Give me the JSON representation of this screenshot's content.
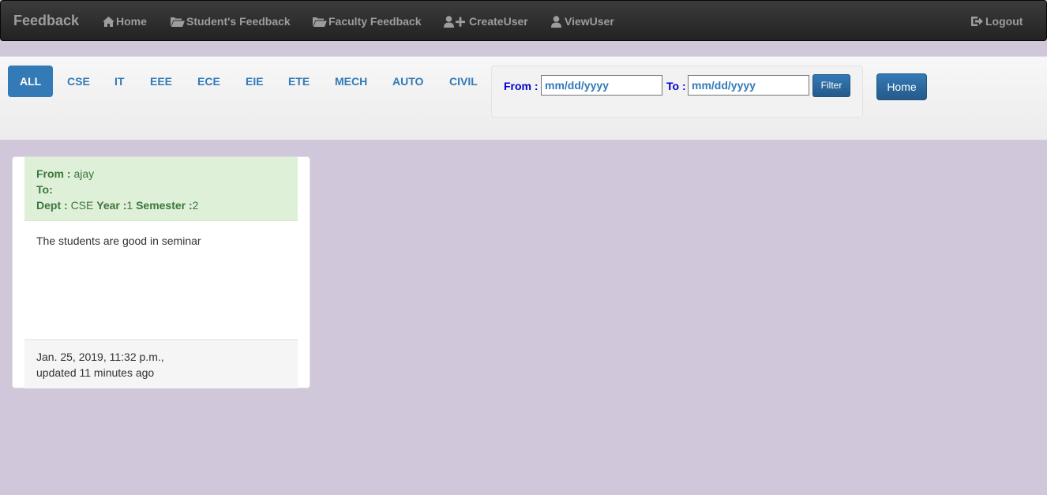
{
  "navbar": {
    "brand": "Feedback",
    "items": [
      {
        "label": "Home",
        "icon": "home-icon"
      },
      {
        "label": "Student's Feedback",
        "icon": "folder-open-icon"
      },
      {
        "label": "Faculty Feedback",
        "icon": "folder-open-icon"
      },
      {
        "label": "CreateUser",
        "icon": "add-user-icon"
      },
      {
        "label": "ViewUser",
        "icon": "user-icon"
      }
    ],
    "logout": {
      "label": "Logout",
      "icon": "logout-icon"
    }
  },
  "filter": {
    "departments": [
      "ALL",
      "CSE",
      "IT",
      "EEE",
      "ECE",
      "EIE",
      "ETE",
      "MECH",
      "AUTO",
      "CIVIL"
    ],
    "active_department": "ALL",
    "from_label": "From :",
    "from_value": "mm/dd/yyyy",
    "to_label": "To :",
    "to_value": "mm/dd/yyyy",
    "filter_button": "Filter",
    "home_button": "Home"
  },
  "feedback_cards": [
    {
      "from_label": "From :",
      "from": "ajay",
      "to_label": "To:",
      "to": "",
      "dept_label": "Dept :",
      "dept": "CSE",
      "year_label": "Year :",
      "year": "1",
      "semester_label": "Semester :",
      "semester": "2",
      "message": "The students are good in seminar",
      "date": "Jan. 25, 2019, 11:32 p.m.,",
      "updated": "updated 11 minutes ago"
    }
  ],
  "colors": {
    "page_background": "#d0c7da",
    "navbar": "#222222",
    "accent": "#337ab7",
    "card_header": "#dff0d8",
    "card_header_text": "#3c763d",
    "date_label": "#0000cc"
  }
}
